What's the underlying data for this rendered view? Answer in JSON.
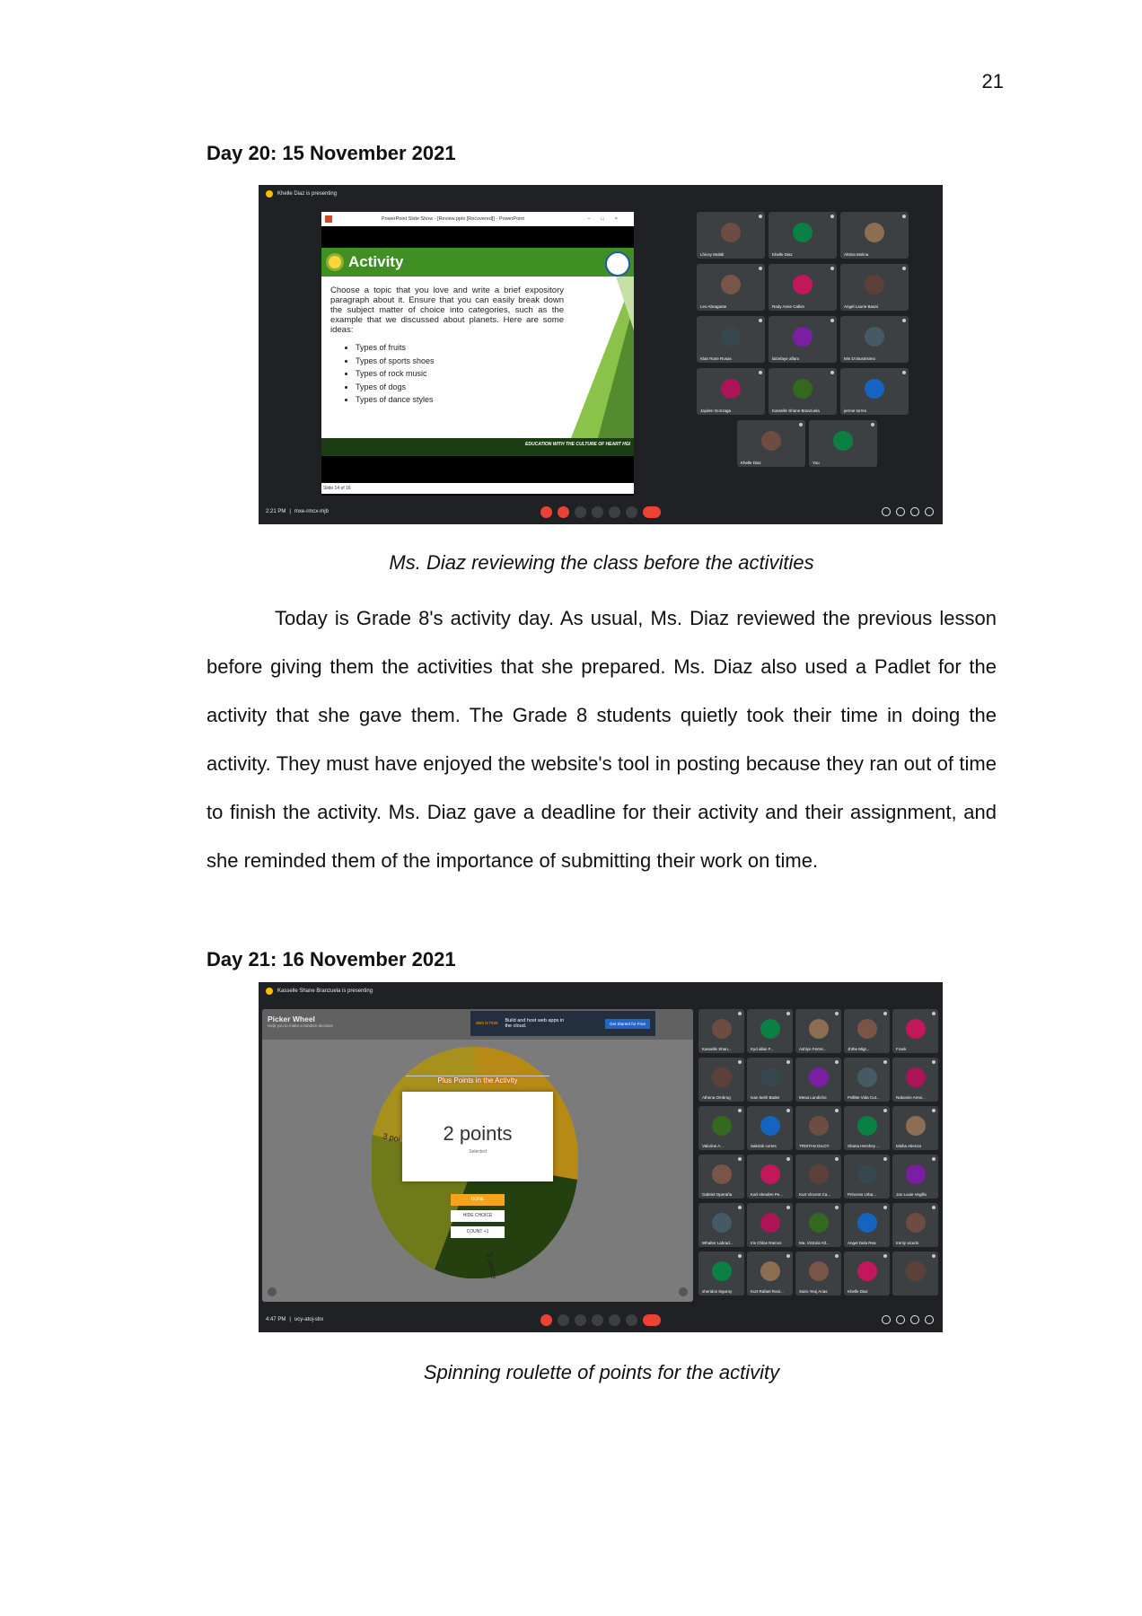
{
  "page_number": "21",
  "day20": {
    "heading": "Day 20: 15 November 2021",
    "caption": "Ms. Diaz reviewing the class before the activities",
    "shot": {
      "presenting": "Khelle Diaz is presenting",
      "window_title": "PowerPoint Slide Show - [Review.pptx [Recovered]] - PowerPoint",
      "slide_title": "Activity",
      "slide_body": "Choose a topic that you love and write a brief expository paragraph about it. Ensure that you can easily break down the subject matter of choice into categories, such as the example that we discussed about planets. Here are some ideas:",
      "slide_items": [
        "Types of fruits",
        "Types of sports shoes",
        "Types of rock music",
        "Types of dogs",
        "Types of dance styles"
      ],
      "slide_footer": "EDUCATION WITH THE CULTURE OF HEART HGI",
      "slide_counter": "Slide 14 of 16",
      "meeting_time": "2:21 PM",
      "meeting_code": "mxe-rmcx-mjb",
      "participants": [
        "Lhicey Mubtli",
        "Khelle Diaz",
        "Ahtina Molina",
        "Leo Abragante",
        "Rady Anne Callon",
        "Angel Laurie Basal",
        "Klair Rose Rosas",
        "lalzefaye alfaro",
        "Min Di Bustrisimo",
        "Jayden Gonzaga",
        "Kasselle Shane Branzuela",
        "jermie torres",
        "Khelle Diaz",
        "You"
      ]
    }
  },
  "body_text": "Today is Grade 8's activity day. As usual, Ms. Diaz reviewed the previous lesson before giving them the activities that she prepared. Ms. Diaz also used a Padlet for the activity that she gave them. The Grade 8 students quietly took their time in doing the activity. They must have enjoyed the website's tool in posting because they ran out of time to finish the activity. Ms. Diaz gave a deadline for their activity and their assignment, and she reminded them of the importance of submitting their work on time.",
  "day21": {
    "heading": "Day 21: 16 November 2021",
    "caption": "Spinning roulette of points for the activity",
    "shot": {
      "presenting": "Kasselle Shane Branzuela is presenting",
      "app_title": "Picker Wheel",
      "app_subtitle": "Help you to make a random decision",
      "ad_text": "Build and host web apps in the cloud.",
      "ad_brand": "aws is how",
      "ad_button": "Get Started for Free",
      "wheel_title": "Plus Points in the Activity",
      "result": "2 points",
      "result_sub": "Selected",
      "buttons": [
        "DONE",
        "HIDE CHOICE",
        "COUNT +1"
      ],
      "wheel_labels": [
        "3 poi",
        "5 points"
      ],
      "meeting_time": "4:47 PM",
      "meeting_code": "ucy-atoj-sbx",
      "participants": [
        "Kasselle Shan...",
        "Kyd allan F...",
        "Ashlyn Ferrer...",
        "Jhthe Migr...",
        "Frank",
        "Athena Ombrog",
        "Ivan keith Bader",
        "Mesa Landicho",
        "Pollitte Vida Cut...",
        "Nakomie Arevi...",
        "Valorine A...",
        "Sakirah cortes",
        "TRISTAN DILOY",
        "Shana Hershey ...",
        "Misha Atienza",
        "Gabriel Operaña",
        "Karl Alendrei Pe...",
        "Kurt Vincent Ca...",
        "Princess Urba...",
        "Jan Louie Vegillo",
        "Whalter Labrad...",
        "Iris Chloe Ramos",
        "Ma. Victoria Alt...",
        "Angel Dela Rea",
        "Irenly vicedo",
        "sheridon leguroy",
        "Kurt Rafael Roni...",
        "Sairo Yeoj Arias",
        "Khelle Diaz",
        ""
      ]
    }
  }
}
